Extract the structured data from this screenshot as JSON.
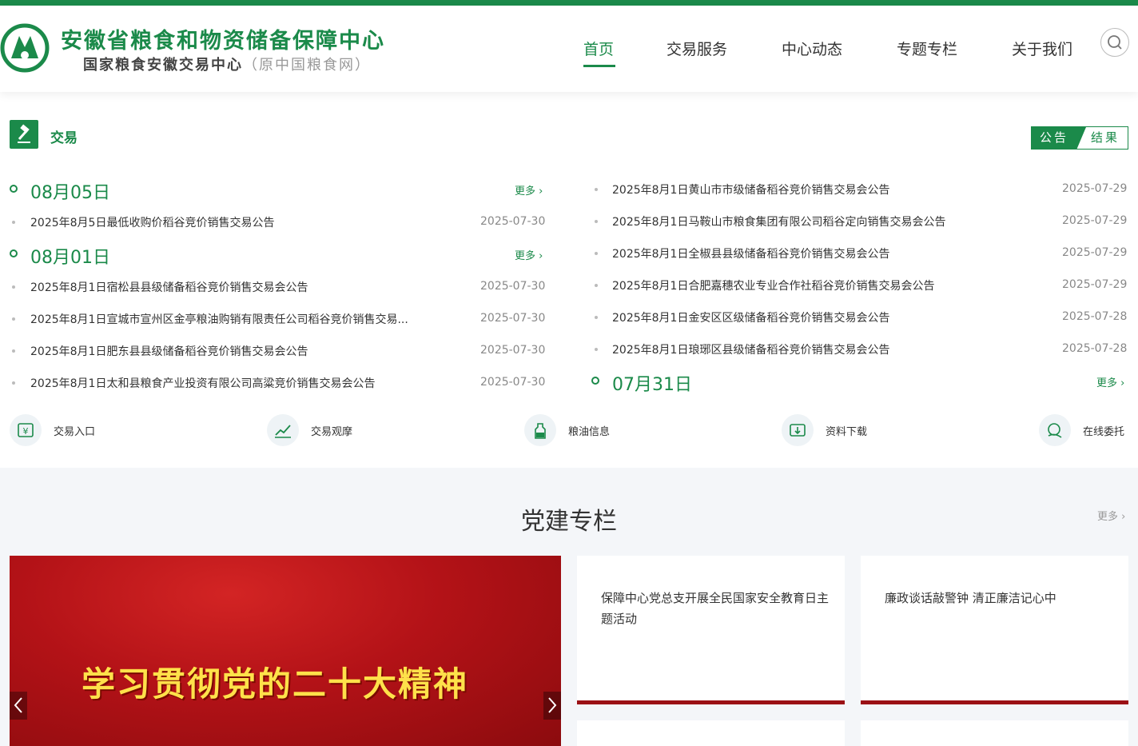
{
  "header": {
    "title": "安徽省粮食和物资储备保障中心",
    "subtitle": "国家粮食安徽交易中心",
    "subtitle_paren": "（原中国粮食网）",
    "nav": [
      "首页",
      "交易服务",
      "中心动态",
      "专题专栏",
      "关于我们"
    ],
    "active_nav": "首页"
  },
  "trade": {
    "title": "交易",
    "tab_notice": "公告",
    "tab_result": "结果",
    "more_label": "更多",
    "left_groups": [
      {
        "date": "08月05日",
        "items": [
          {
            "title": "2025年8月5日最低收购价稻谷竞价销售交易公告",
            "date": "2025-07-30"
          }
        ]
      },
      {
        "date": "08月01日",
        "items": [
          {
            "title": "2025年8月1日宿松县县级储备稻谷竞价销售交易会公告",
            "date": "2025-07-30"
          },
          {
            "title": "2025年8月1日宣城市宣州区金亭粮油购销有限责任公司稻谷竞价销售交易...",
            "date": "2025-07-30"
          },
          {
            "title": "2025年8月1日肥东县县级储备稻谷竞价销售交易会公告",
            "date": "2025-07-30"
          },
          {
            "title": "2025年8月1日太和县粮食产业投资有限公司高粱竞价销售交易会公告",
            "date": "2025-07-30"
          }
        ]
      }
    ],
    "right_items": [
      {
        "title": "2025年8月1日黄山市市级储备稻谷竞价销售交易会公告",
        "date": "2025-07-29"
      },
      {
        "title": "2025年8月1日马鞍山市粮食集团有限公司稻谷定向销售交易会公告",
        "date": "2025-07-29"
      },
      {
        "title": "2025年8月1日全椒县县级储备稻谷竞价销售交易会公告",
        "date": "2025-07-29"
      },
      {
        "title": "2025年8月1日合肥嘉穗农业专业合作社稻谷竞价销售交易会公告",
        "date": "2025-07-29"
      },
      {
        "title": "2025年8月1日金安区区级储备稻谷竞价销售交易会公告",
        "date": "2025-07-28"
      },
      {
        "title": "2025年8月1日琅琊区县级储备稻谷竞价销售交易会公告",
        "date": "2025-07-28"
      }
    ],
    "right_group_date": "07月31日"
  },
  "quick_links": [
    {
      "label": "交易入口",
      "icon": "yen-icon"
    },
    {
      "label": "交易观摩",
      "icon": "trend-chart-icon"
    },
    {
      "label": "粮油信息",
      "icon": "oil-bottle-icon"
    },
    {
      "label": "资料下载",
      "icon": "download-icon"
    },
    {
      "label": "在线委托",
      "icon": "handshake-icon"
    }
  ],
  "party": {
    "title": "党建专栏",
    "more_label": "更多",
    "banner_text": "学习贯彻党的二十大精神",
    "cards": [
      "保障中心党总支开展全民国家安全教育日主题活动",
      "廉政谈话敲警钟 清正廉洁记心中"
    ]
  },
  "colors": {
    "brand_green": "#1b8a4a",
    "party_red": "#b31217",
    "banner_text": "#ffe14a"
  }
}
